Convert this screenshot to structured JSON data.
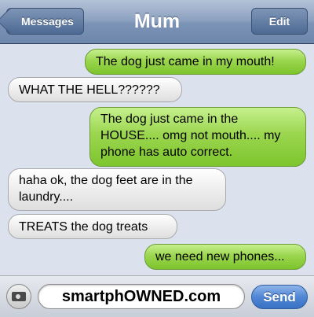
{
  "navbar": {
    "back_label": "Messages",
    "title": "Mum",
    "edit_label": "Edit"
  },
  "messages": [
    {
      "from": "me",
      "text": "The dog just came in my mouth!"
    },
    {
      "from": "them",
      "text": "WHAT THE HELL??????"
    },
    {
      "from": "me",
      "text": "The dog just came in the HOUSE.... omg not mouth.... my phone has auto correct."
    },
    {
      "from": "them",
      "text": "haha ok, the dog feet are in the laundry...."
    },
    {
      "from": "them",
      "text": "TREATS the dog treats"
    },
    {
      "from": "me",
      "text": "we need new phones..."
    }
  ],
  "composer": {
    "camera_icon": "camera-icon",
    "field_text": "smartphOWNED.com",
    "send_label": "Send"
  },
  "colors": {
    "sent_bubble": "#9bd64f",
    "received_bubble": "#eeeeee",
    "navbar": "#7b93b6",
    "send_button": "#4f86d4",
    "background": "#dbe2ed"
  }
}
